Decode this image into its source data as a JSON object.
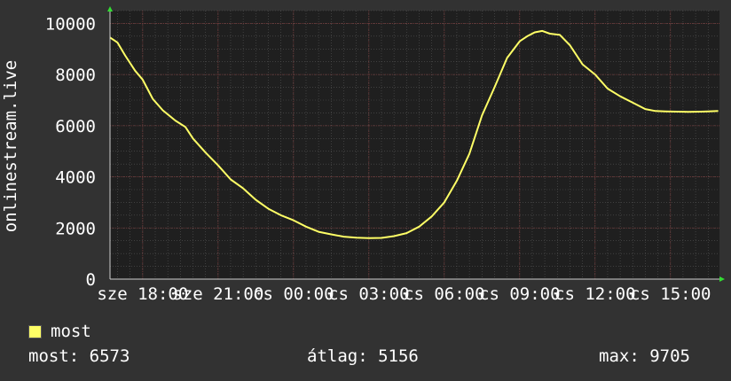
{
  "chart_data": {
    "type": "line",
    "ylabel": "onlinestream.live",
    "ylim": [
      0,
      10500
    ],
    "yticks": [
      0,
      2000,
      4000,
      6000,
      8000,
      10000
    ],
    "xlim": [
      16.7,
      40.95
    ],
    "xticks": [
      {
        "x": 18,
        "label": "sze 18:00"
      },
      {
        "x": 21,
        "label": "sze 21:00"
      },
      {
        "x": 24,
        "label": "cs 00:00"
      },
      {
        "x": 27,
        "label": "cs 03:00"
      },
      {
        "x": 30,
        "label": "cs 06:00"
      },
      {
        "x": 33,
        "label": "cs 09:00"
      },
      {
        "x": 36,
        "label": "cs 12:00"
      },
      {
        "x": 39,
        "label": "cs 15:00"
      }
    ],
    "grid": true,
    "series": [
      {
        "name": "most",
        "color": "#ffff66",
        "x": [
          16.7,
          17.0,
          17.3,
          17.7,
          18.0,
          18.4,
          18.8,
          19.3,
          19.7,
          20.0,
          20.5,
          21.0,
          21.5,
          22.0,
          22.5,
          23.0,
          23.5,
          24.0,
          24.5,
          25.0,
          25.5,
          26.0,
          26.5,
          27.0,
          27.5,
          28.0,
          28.5,
          29.0,
          29.5,
          30.0,
          30.5,
          31.0,
          31.5,
          32.0,
          32.5,
          33.0,
          33.3,
          33.6,
          33.9,
          34.2,
          34.6,
          35.0,
          35.5,
          36.0,
          36.5,
          37.0,
          37.5,
          38.0,
          38.4,
          38.8,
          39.3,
          39.7,
          40.2,
          40.5,
          40.9
        ],
        "y": [
          9450,
          9250,
          8750,
          8150,
          7800,
          7050,
          6600,
          6200,
          5950,
          5500,
          4950,
          4450,
          3900,
          3550,
          3100,
          2750,
          2500,
          2300,
          2050,
          1850,
          1750,
          1660,
          1620,
          1600,
          1610,
          1680,
          1800,
          2050,
          2450,
          3000,
          3850,
          4900,
          6400,
          7500,
          8650,
          9300,
          9500,
          9650,
          9705,
          9600,
          9550,
          9150,
          8400,
          8000,
          7450,
          7150,
          6900,
          6650,
          6573,
          6560,
          6550,
          6540,
          6550,
          6560,
          6573
        ]
      }
    ]
  },
  "legend": {
    "label": "most",
    "color": "#ffff66"
  },
  "stats": {
    "now": "most: 6573",
    "avg": "átlag: 5156",
    "max": "max: 9705"
  }
}
